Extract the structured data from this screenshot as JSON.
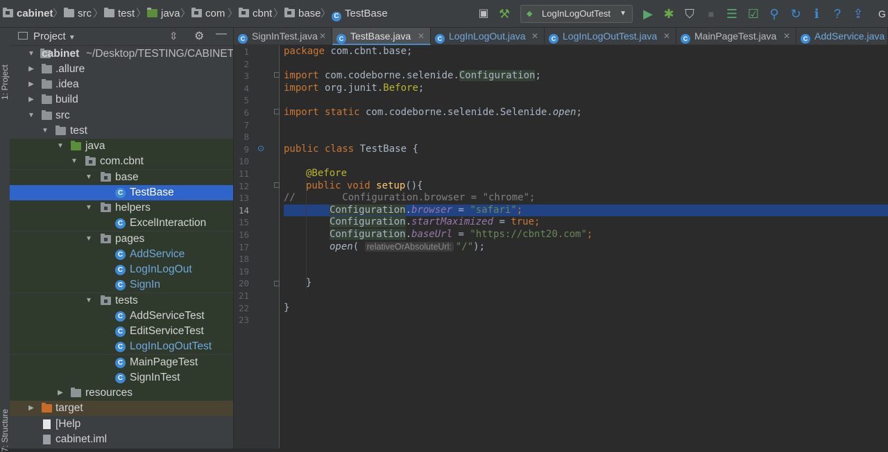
{
  "breadcrumbs": [
    "cabinet",
    "src",
    "test",
    "java",
    "com",
    "cbnt",
    "base",
    "TestBase"
  ],
  "run_config": {
    "label": "LogInLogOutTest"
  },
  "toolbar_right_text": "G",
  "left_strip": {
    "project_tab": "1: Project",
    "structure_tab": "7: Structure"
  },
  "project_panel": {
    "title": "Project"
  },
  "tree": [
    {
      "label": "cabinet",
      "suffix": "~/Desktop/TESTING/CABINET"
    },
    {
      "label": ".allure"
    },
    {
      "label": ".idea"
    },
    {
      "label": "build"
    },
    {
      "label": "src"
    },
    {
      "label": "test"
    },
    {
      "label": "java"
    },
    {
      "label": "com.cbnt"
    },
    {
      "label": "base"
    },
    {
      "label": "TestBase"
    },
    {
      "label": "helpers"
    },
    {
      "label": "ExcelInteraction"
    },
    {
      "label": "pages"
    },
    {
      "label": "AddService"
    },
    {
      "label": "LogInLogOut"
    },
    {
      "label": "SignIn"
    },
    {
      "label": "tests"
    },
    {
      "label": "AddServiceTest"
    },
    {
      "label": "EditServiceTest"
    },
    {
      "label": "LogInLogOutTest"
    },
    {
      "label": "MainPageTest"
    },
    {
      "label": "SignInTest"
    },
    {
      "label": "resources"
    },
    {
      "label": "target"
    },
    {
      "label": "[Help"
    },
    {
      "label": "cabinet.iml"
    }
  ],
  "tabs": [
    {
      "label": "SignInTest.java"
    },
    {
      "label": "TestBase.java"
    },
    {
      "label": "LogInLogOut.java"
    },
    {
      "label": "LogInLogOutTest.java"
    },
    {
      "label": "MainPageTest.java"
    },
    {
      "label": "AddService.java"
    }
  ],
  "code": {
    "line_numbers": [
      "1",
      "2",
      "3",
      "4",
      "5",
      "6",
      "7",
      "8",
      "9",
      "10",
      "11",
      "12",
      "13",
      "14",
      "15",
      "16",
      "17",
      "18",
      "19",
      "20",
      "21",
      "22",
      "23"
    ],
    "current_line": 14,
    "l1": {
      "k": "package",
      "rest": " com.cbnt.base;"
    },
    "l3": {
      "k": "import",
      "a": " com.codeborne.selenide.",
      "b": "Configuration",
      "c": ";"
    },
    "l4": {
      "k": "import",
      "a": " org.junit.",
      "b": "Before",
      "c": ";"
    },
    "l6": {
      "k": "import static",
      "a": " com.codeborne.selenide.Selenide.",
      "b": "open",
      "c": ";"
    },
    "l9": {
      "k": "public class",
      "rest": " TestBase {"
    },
    "l11": {
      "ann": "@Before"
    },
    "l12": {
      "k": "public void",
      "fn": "setup",
      "rest": "(){"
    },
    "l13": {
      "comment": "//        Configuration.browser = \"chrome\";"
    },
    "l14": {
      "cls": "Configuration",
      "dot": ".",
      "fld": "browser",
      "eq": " = ",
      "str": "\"safari\"",
      "end": ";"
    },
    "l15": {
      "cls": "Configuration",
      "dot": ".",
      "fld": "startMaximized",
      "eq": " = ",
      "kw": "true",
      "end": ";"
    },
    "l16": {
      "cls": "Configuration",
      "dot": ".",
      "fld": "baseUrl",
      "eq": " = ",
      "str": "\"https://cbnt20.com\"",
      "end": ";"
    },
    "l17": {
      "fn": "open",
      "paren": "(",
      "hint": "relativeOrAbsoluteUrl:",
      "str": "\"/\"",
      "end": ");"
    },
    "l20": {
      "rest": "}"
    },
    "l22": {
      "rest": "}"
    }
  },
  "colors": {
    "selection": "#2f65ca",
    "caret_line": "#214283",
    "keyword": "#cc7832",
    "string": "#6a8759"
  }
}
